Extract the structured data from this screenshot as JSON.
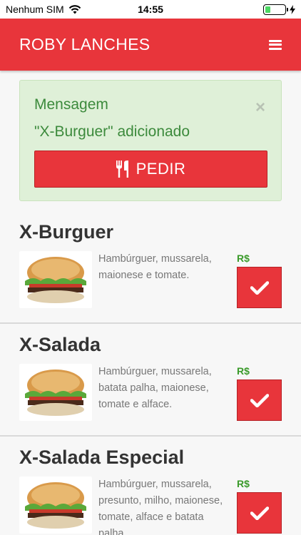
{
  "status_bar": {
    "carrier": "Nenhum SIM",
    "time": "14:55",
    "battery_level": 0.25,
    "battery_color": "#4cd964"
  },
  "navbar": {
    "brand": "ROBY LANCHES",
    "menu_icon": "hamburger-menu-icon",
    "color": "#e8353b"
  },
  "alert": {
    "title": "Mensagem",
    "message": "\"X-Burguer\" adicionado",
    "close_symbol": "×",
    "order_button_label": "PEDIR",
    "order_button_icon": "cutlery-icon"
  },
  "products": [
    {
      "name": "X-Burguer",
      "description": "Hambúrguer, mussarela, maionese e tomate.",
      "price_label": "R$",
      "button_icon": "check-icon"
    },
    {
      "name": "X-Salada",
      "description": "Hambúrguer, mussarela, batata palha, maionese, tomate e alface.",
      "price_label": "R$",
      "button_icon": "check-icon"
    },
    {
      "name": "X-Salada Especial",
      "description": "Hambúrguer, mussarela, presunto, milho, maionese, tomate, alface e batata palha.",
      "price_label": "R$",
      "button_icon": "check-icon"
    }
  ]
}
